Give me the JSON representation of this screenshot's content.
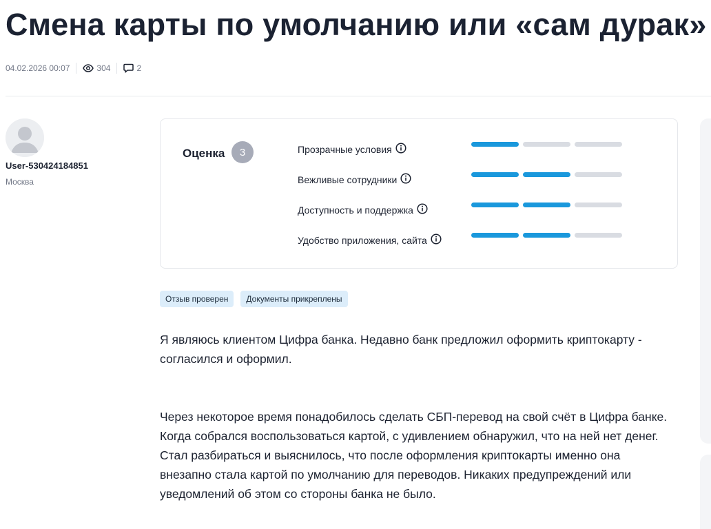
{
  "article": {
    "title": "Смена карты по умолчанию или «сам дурак»",
    "date": "04.02.2026 00:07",
    "views": "304",
    "comments": "2"
  },
  "author": {
    "username": "User-530424184851",
    "city": "Москва"
  },
  "rating": {
    "label": "Оценка",
    "score": "3",
    "criteria": [
      {
        "name": "Прозрачные условия",
        "value": 1,
        "max": 3
      },
      {
        "name": "Вежливые сотрудники",
        "value": 2,
        "max": 3
      },
      {
        "name": "Доступность и поддержка",
        "value": 2,
        "max": 3
      },
      {
        "name": "Удобство приложения, сайта",
        "value": 2,
        "max": 3
      }
    ]
  },
  "tags": [
    "Отзыв проверен",
    "Документы прикреплены"
  ],
  "review": {
    "p1": "Я являюсь клиентом Цифра банка. Недавно банк предложил оформить криптокарту - согласился и оформил.",
    "p2": "Через некоторое время понадобилось сделать СБП-перевод на свой счёт в Цифра банке.",
    "p3": "Когда собрался воспользоваться картой, с удивлением обнаружил, что на ней нет денег. Стал разбираться и выяснилось, что после оформления криптокарты именно она внезапно стала картой по умолчанию для переводов. Никаких предупреждений или уведомлений об этом со стороны банка не было."
  },
  "icons": {
    "views": "eye-icon",
    "comments": "comment-icon",
    "info": "info-icon"
  },
  "colors": {
    "bar_active": "#1a98dc",
    "bar_inactive": "#d9dce2",
    "tag_bg": "#dcedfa",
    "badge_bg": "#a7abb8"
  }
}
